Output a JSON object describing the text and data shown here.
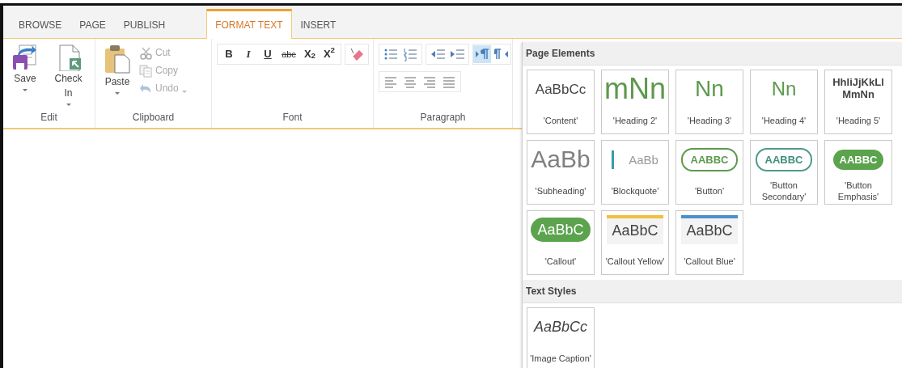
{
  "tabs": [
    {
      "label": "BROWSE",
      "selected": false
    },
    {
      "label": "PAGE",
      "selected": false
    },
    {
      "label": "PUBLISH",
      "selected": false
    },
    {
      "label": "FORMAT TEXT",
      "selected": true
    },
    {
      "label": "INSERT",
      "selected": false
    }
  ],
  "edit_group": {
    "label": "Edit",
    "buttons": [
      {
        "label": "Save"
      },
      {
        "label": "Check In"
      }
    ]
  },
  "clipboard_group": {
    "label": "Clipboard",
    "paste": {
      "label": "Paste"
    },
    "actions": [
      {
        "label": "Cut",
        "disabled": true
      },
      {
        "label": "Copy",
        "disabled": true
      },
      {
        "label": "Undo",
        "disabled": true
      }
    ]
  },
  "font_group": {
    "label": "Font",
    "buttons": [
      {
        "label": "B",
        "kind": "bold"
      },
      {
        "label": "I",
        "kind": "italic"
      },
      {
        "label": "U",
        "kind": "underline"
      },
      {
        "label": "abc",
        "kind": "strike"
      },
      {
        "label": "X$_{2}$",
        "kind": "plain"
      },
      {
        "label": "X$^{2}$",
        "kind": "plain"
      }
    ]
  },
  "paragraph_group": {
    "label": "Paragraph",
    "direction_buttons": [
      {
        "selected": true
      },
      {
        "selected": false
      }
    ]
  },
  "gallery": {
    "sections": [
      {
        "title": "Page Elements",
        "items": [
          {
            "kind": "content",
            "sample": "AaBbCc",
            "label": "'Content'"
          },
          {
            "kind": "heading2",
            "sample": "mNn",
            "label": "'Heading 2'"
          },
          {
            "kind": "heading3",
            "sample": "Nn",
            "label": "'Heading 3'"
          },
          {
            "kind": "heading4",
            "sample": "Nn",
            "label": "'Heading 4'"
          },
          {
            "kind": "heading5",
            "sample": "HhIiJjKkLlMmNn",
            "label": "'Heading 5'"
          },
          {
            "kind": "subheading",
            "sample": "AaBb",
            "label": "'Subheading'"
          },
          {
            "kind": "blockquote",
            "sample": "AaBb",
            "label": "'Blockquote'"
          },
          {
            "kind": "button",
            "sample": "AABBC",
            "label": "'Button'"
          },
          {
            "kind": "button-secondary",
            "sample": "AABBC",
            "label": "'Button Secondary'"
          },
          {
            "kind": "button-emphasis",
            "sample": "AABBC",
            "label": "'Button Emphasis'"
          },
          {
            "kind": "callout",
            "sample": "AaBbC",
            "label": "'Callout'"
          },
          {
            "kind": "callout-yellow",
            "sample": "AaBbC",
            "label": "'Callout Yellow'"
          },
          {
            "kind": "callout-blue",
            "sample": "AaBbC",
            "label": "'Callout Blue'"
          }
        ]
      },
      {
        "title": "Text Styles",
        "items": [
          {
            "kind": "caption",
            "sample": "AaBbCc",
            "label": "'Image Caption'"
          }
        ]
      }
    ]
  }
}
